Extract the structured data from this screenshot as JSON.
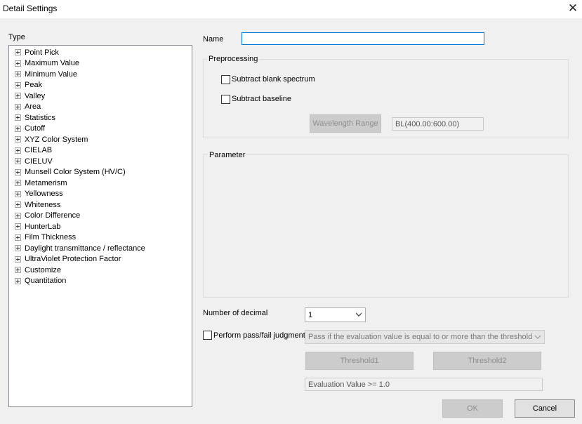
{
  "window": {
    "title": "Detail Settings"
  },
  "type_panel": {
    "label": "Type",
    "items": [
      "Point Pick",
      "Maximum Value",
      "Minimum Value",
      "Peak",
      "Valley",
      "Area",
      "Statistics",
      "Cutoff",
      "XYZ Color System",
      "CIELAB",
      "CIELUV",
      "Munsell Color System (HV/C)",
      "Metamerism",
      "Yellowness",
      "Whiteness",
      "Color Difference",
      "HunterLab",
      "Film Thickness",
      "Daylight transmittance / reflectance",
      "UltraViolet Protection Factor",
      "Customize",
      "Quantitation"
    ]
  },
  "name": {
    "label": "Name",
    "value": ""
  },
  "preprocessing": {
    "label": "Preprocessing",
    "subtract_blank": "Subtract blank spectrum",
    "subtract_baseline": "Subtract baseline",
    "wavelength_button": "Wavelength Range",
    "wavelength_value": "BL(400.00:600.00)"
  },
  "parameter": {
    "label": "Parameter"
  },
  "decimal": {
    "label": "Number of decimal",
    "value": "1"
  },
  "judgment": {
    "label": "Perform pass/fail judgment",
    "mode": "Pass if the evaluation value is equal to or more than the threshold",
    "threshold1": "Threshold1",
    "threshold2": "Threshold2",
    "evaluation": "Evaluation Value >= 1.0"
  },
  "buttons": {
    "ok": "OK",
    "cancel": "Cancel"
  },
  "icons": {
    "close": "close-icon",
    "expand": "plus-box-icon",
    "dropdown": "chevron-down-icon"
  }
}
